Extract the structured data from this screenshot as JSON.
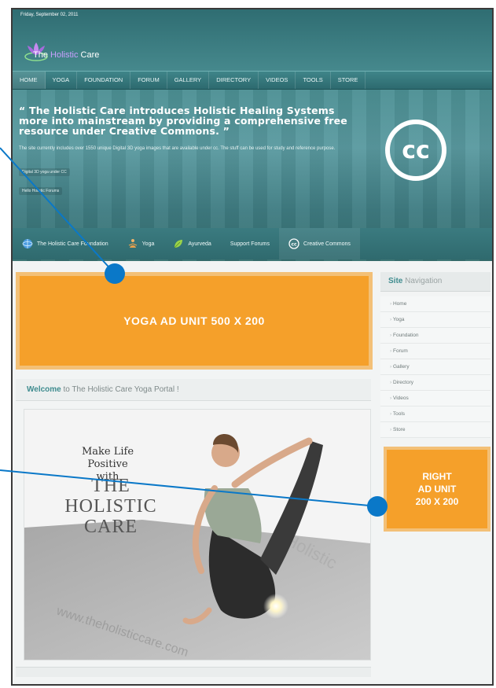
{
  "header": {
    "date": "Friday, September 02, 2011",
    "logo": {
      "prefix": "The",
      "accent": "Holistic",
      "suffix": "Care"
    },
    "nav": [
      "HOME",
      "YOGA",
      "FOUNDATION",
      "FORUM",
      "GALLERY",
      "DIRECTORY",
      "VIDEOS",
      "TOOLS",
      "STORE"
    ],
    "active_nav": "HOME",
    "quote": "“ The Holistic Care introduces Holistic Healing Systems more into mainstream by providing a comprehensive free resource under Creative Commons. ”",
    "description": "The site currently includes over 1550 unique Digital 3D yoga images that are available under cc. The stuff can be used for study and reference purpose.",
    "links": [
      "Digital 3D yoga under CC",
      "Hello Holistic Forums"
    ],
    "cc_badge": "cc"
  },
  "feature_bar": [
    {
      "label": "The Holistic Care Foundation",
      "icon": "globe-icon"
    },
    {
      "label": "Yoga",
      "icon": "meditation-icon"
    },
    {
      "label": "Ayurveda",
      "icon": "leaf-icon"
    },
    {
      "label": "Support Forums",
      "icon": ""
    },
    {
      "label": "Creative Commons",
      "icon": "cc-icon"
    }
  ],
  "main": {
    "ad_main": "YOGA  AD UNIT  500 X 200",
    "welcome_bold": "Welcome",
    "welcome_rest": " to The Holistic Care Yoga Portal !",
    "hero": {
      "line1": "Make Life Positive",
      "line2": "with",
      "line3": "THE",
      "line4": "HOLISTIC",
      "line5": "CARE"
    }
  },
  "sidebar": {
    "title_bold": "Site",
    "title_rest": " Navigation",
    "items": [
      "Home",
      "Yoga",
      "Foundation",
      "Forum",
      "Gallery",
      "Directory",
      "Videos",
      "Tools",
      "Store"
    ],
    "ad_right": [
      "RIGHT",
      "AD UNIT",
      "200 X 200"
    ]
  },
  "colors": {
    "accent_orange": "#f5a02a",
    "header_teal": "#3f7c82",
    "callout_blue": "#0a78c8"
  }
}
